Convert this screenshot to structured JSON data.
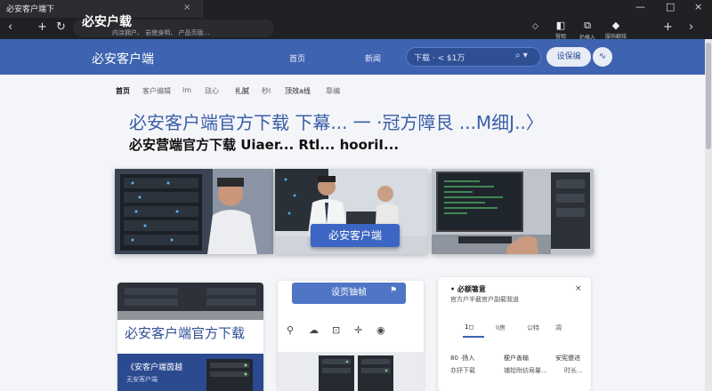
{
  "browser": {
    "tab_title": "必安客户端下",
    "tab_close": "×",
    "window_controls": [
      "—",
      "□",
      "×"
    ],
    "omnibox_title": "必安户载",
    "omnibox_sub": "内涂拥户、  岩使身明、  产品页版…",
    "extensions": [
      {
        "icon": "◧",
        "label": "营观"
      },
      {
        "icon": "⧉",
        "label": "扔搞入"
      },
      {
        "icon": "◆",
        "label": "服饰翻铭"
      }
    ]
  },
  "header": {
    "brand": "必安客户端",
    "nav": [
      "首页",
      "新闻"
    ],
    "search": {
      "value": "下载 · < $1万",
      "icon": "⌕ ▾"
    },
    "button_label": "设保编",
    "round_icon": "∿"
  },
  "subnav": [
    "首页",
    "客户编辑",
    "lm",
    "琺心",
    "扎腻",
    "秒l",
    "顶效a线",
    "靠编"
  ],
  "headings": {
    "h1": "必安客户端官方下载 下幕... 一 ·冠方障艮 ...M细J..〉",
    "h2": "必安营端官方下载 Uiaer... Rtl... hooriI..."
  },
  "hero": {
    "badge": "必安客户端"
  },
  "cards": {
    "card1_title": "必安客户端官方下载",
    "card1_footer_title": "《安客户端茵越",
    "card1_footer_sub": "无安客户端",
    "card2_button": "设页铀帧",
    "card2_flag": "⚑",
    "card2_icons": [
      "⚲",
      "☁",
      "⊡",
      "✛",
      "◉"
    ],
    "panel": {
      "title": "• 必额箸意",
      "desc": "官方户半截官户副载我道",
      "close": "×",
      "tabs": [
        "1◻",
        "lI房",
        "公特",
        "凋"
      ],
      "values_row1": [
        "80 ·扬入",
        "梗户善输",
        "安宪傻进"
      ],
      "values_row2": [
        "亦抒下载",
        "铺拾附纺局量...",
        "时长..."
      ]
    }
  },
  "colors": {
    "brand_blue": "#3d63b1",
    "headline_blue": "#3a5ea8"
  }
}
